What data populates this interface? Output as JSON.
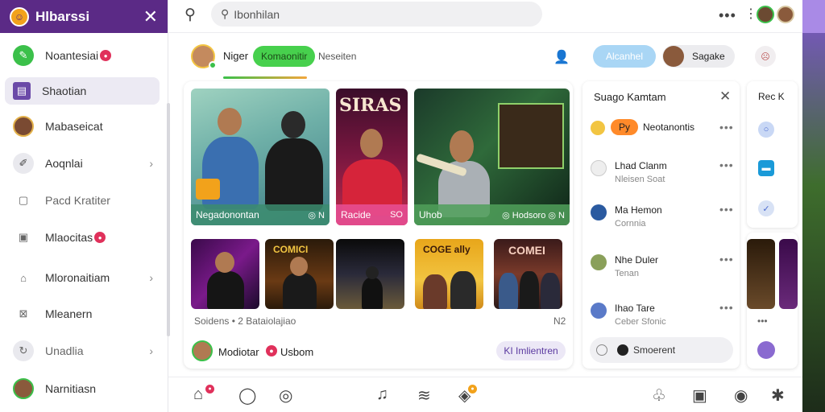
{
  "sidebar": {
    "title": "Hlbarssi",
    "items": [
      {
        "label": "Noantesiai",
        "icon": "leaf-icon",
        "badge": "●"
      },
      {
        "label": "Shaotian",
        "icon": "bookmark-icon"
      },
      {
        "label": "Mabaseicat",
        "icon": "avatar-icon"
      },
      {
        "label": "Aoqnlai",
        "icon": "pen-icon"
      },
      {
        "label": "Pacd Kratiter",
        "icon": "calendar-icon"
      },
      {
        "label": "Mlaocitas",
        "icon": "image-icon",
        "badge": "●"
      },
      {
        "label": "Mloronaitiam",
        "icon": "home-icon"
      },
      {
        "label": "Mleanern",
        "icon": "box-x-icon"
      },
      {
        "label": "Unadlia",
        "icon": "refresh-icon"
      },
      {
        "label": "Narnitiasn",
        "icon": "avatar-icon"
      }
    ]
  },
  "topbar": {
    "search_placeholder": "Ibonhilan",
    "more": "•••"
  },
  "profile_row": {
    "name": "Niger",
    "pill": "Komaonitir",
    "link": "Neseiten",
    "accent_button": "Alcanhel",
    "chip_name": "Sagake"
  },
  "media": {
    "cards": [
      {
        "caption": "Negadonontan",
        "meta": "◎ N"
      },
      {
        "caption": "Racide",
        "meta": "SO"
      },
      {
        "caption": "Uhob",
        "meta": "◎ Hodsoro ◎ N"
      }
    ],
    "card_sign": "SIRAS",
    "thumb_sign_1": "COMICI",
    "thumb_sign_2": "COGE ally",
    "thumb_sign_3": "COMEI",
    "caption": "Soidens • 2 Bataiolajiao",
    "number": "N2",
    "footer_name": "Modiotar",
    "footer_link": "Usbom",
    "footer_button": "KI Imlientren"
  },
  "suggestions": {
    "title": "Suago Kamtam",
    "rows": [
      {
        "pill": "Py",
        "name": "Neotanontis",
        "sub": ""
      },
      {
        "name": "Lhad Clanm",
        "sub": "Nleisen Soat"
      },
      {
        "name": "Ma Hemon",
        "sub": "Cornnia"
      },
      {
        "name": "Nhe Duler",
        "sub": "Tenan"
      },
      {
        "name": "Ihao Tare",
        "sub": "Ceber Sfonic"
      }
    ],
    "input": "Smoerent"
  },
  "mini": {
    "title": "Rec K"
  },
  "colors": {
    "sidebar_header": "#5b2a86",
    "accent_green": "#47d04d",
    "accent_blue": "#a9d6f5",
    "badge_red": "#e0315b"
  }
}
